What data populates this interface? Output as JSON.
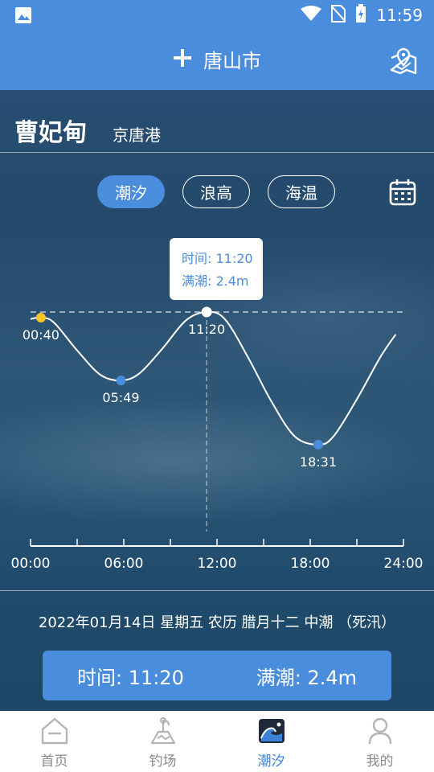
{
  "status_bar": {
    "time": "11:59"
  },
  "header": {
    "title": "唐山市",
    "add_icon": "plus-icon",
    "map_icon": "map-pin-icon"
  },
  "location": {
    "place": "曹妃甸",
    "port": "京唐港"
  },
  "tabs": [
    {
      "label": "潮汐",
      "active": true
    },
    {
      "label": "浪高",
      "active": false
    },
    {
      "label": "海温",
      "active": false
    }
  ],
  "tooltip": {
    "time_line": "时间: 11:20",
    "tide_line": "满潮: 2.4m"
  },
  "chart_data": {
    "type": "line",
    "x_ticks": [
      "00:00",
      "06:00",
      "12:00",
      "18:00",
      "24:00"
    ],
    "series": [
      {
        "values_note": "",
        "points": [
          {
            "time": "00:00",
            "height": 2.3
          },
          {
            "time": "00:40",
            "height": 2.32
          },
          {
            "time": "01:30",
            "height": 2.25
          },
          {
            "time": "03:00",
            "height": 1.85
          },
          {
            "time": "04:30",
            "height": 1.5
          },
          {
            "time": "05:49",
            "height": 1.42
          },
          {
            "time": "07:00",
            "height": 1.52
          },
          {
            "time": "08:30",
            "height": 1.88
          },
          {
            "time": "10:00",
            "height": 2.28
          },
          {
            "time": "11:20",
            "height": 2.4
          },
          {
            "time": "12:30",
            "height": 2.3
          },
          {
            "time": "14:00",
            "height": 1.75
          },
          {
            "time": "15:30",
            "height": 1.12
          },
          {
            "time": "17:00",
            "height": 0.62
          },
          {
            "time": "18:31",
            "height": 0.5
          },
          {
            "time": "19:30",
            "height": 0.62
          },
          {
            "time": "21:00",
            "height": 1.15
          },
          {
            "time": "22:30",
            "height": 1.75
          },
          {
            "time": "23:30",
            "height": 2.08
          }
        ]
      }
    ],
    "markers": [
      {
        "time": "00:40",
        "label": "00:40",
        "kind": "high",
        "color": "#f5c52a"
      },
      {
        "time": "05:49",
        "label": "05:49",
        "kind": "low",
        "color": "#4a8ddc"
      },
      {
        "time": "11:20",
        "label": "11:20",
        "kind": "high",
        "color": "#ffffff"
      },
      {
        "time": "18:31",
        "label": "18:31",
        "kind": "low",
        "color": "#4a8ddc"
      }
    ],
    "selected_time": "11:20",
    "ylim": [
      0,
      3.2
    ],
    "grid": false
  },
  "date_text": "2022年01月14日 星期五 农历 腊月十二 中潮 （死汛）",
  "info": {
    "time_text": "时间: 11:20",
    "tide_text": "满潮: 2.4m"
  },
  "nav": [
    {
      "label": "首页",
      "icon": "home-icon",
      "active": false
    },
    {
      "label": "钓场",
      "icon": "fishing-spot-icon",
      "active": false
    },
    {
      "label": "潮汐",
      "icon": "tide-wave-icon",
      "active": true
    },
    {
      "label": "我的",
      "icon": "user-icon",
      "active": false
    }
  ],
  "colors": {
    "accent": "#4a8ddc",
    "high_marker": "#f5c52a"
  }
}
